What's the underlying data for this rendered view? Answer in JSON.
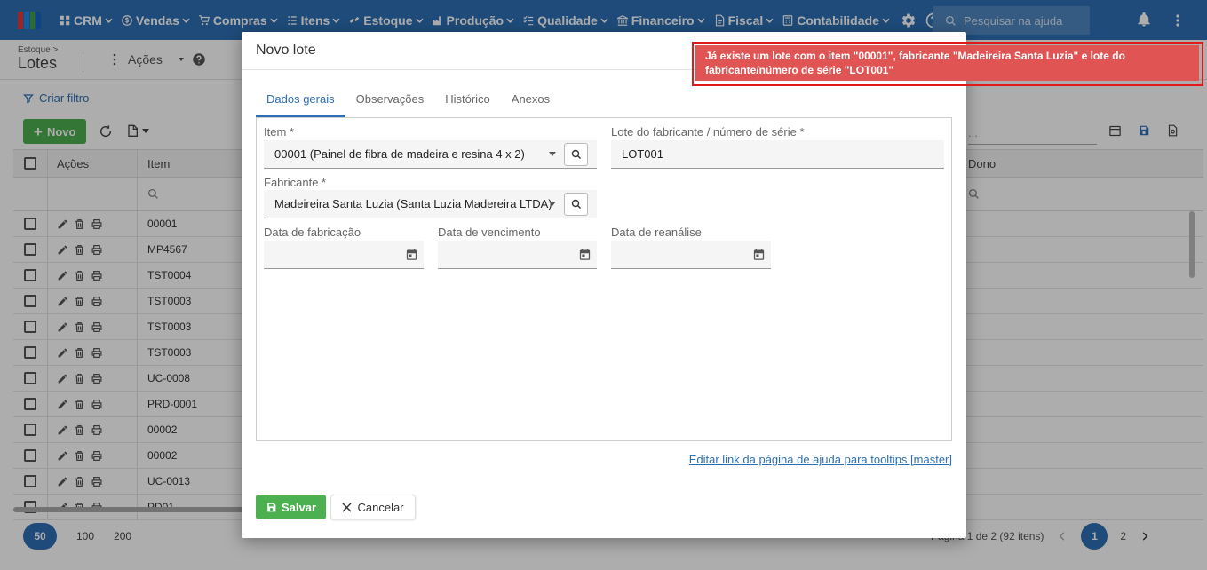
{
  "nav": {
    "items": [
      {
        "label": "CRM",
        "icon": "crm-icon"
      },
      {
        "label": "Vendas",
        "icon": "dollar-icon"
      },
      {
        "label": "Compras",
        "icon": "cart-icon"
      },
      {
        "label": "Itens",
        "icon": "items-icon"
      },
      {
        "label": "Estoque",
        "icon": "stock-icon"
      },
      {
        "label": "Produção",
        "icon": "factory-icon"
      },
      {
        "label": "Qualidade",
        "icon": "quality-icon"
      },
      {
        "label": "Financeiro",
        "icon": "finance-icon"
      },
      {
        "label": "Fiscal",
        "icon": "fiscal-icon"
      },
      {
        "label": "Contabilidade",
        "icon": "accounting-icon"
      }
    ],
    "search_placeholder": "Pesquisar na ajuda"
  },
  "page": {
    "breadcrumb": "Estoque >",
    "title": "Lotes",
    "actions_label": "Ações",
    "filter_label": "Criar filtro",
    "new_label": "Novo"
  },
  "grid": {
    "columns": [
      "Ações",
      "Item",
      "Dono"
    ],
    "rows": [
      "00001",
      "MP4567",
      "TST0004",
      "TST0003",
      "TST0003",
      "TST0003",
      "UC-0008",
      "PRD-0001",
      "00002",
      "00002",
      "UC-0013",
      "PD01"
    ],
    "search_placeholder": "...",
    "page_sizes": [
      "50",
      "100",
      "200"
    ],
    "page_info": "Página 1 de 2 (92 itens)",
    "pages": [
      "1",
      "2"
    ]
  },
  "modal": {
    "title": "Novo lote",
    "tabs": [
      "Dados gerais",
      "Observações",
      "Histórico",
      "Anexos"
    ],
    "fields": {
      "item_label": "Item *",
      "item_value": "00001 (Painel de fibra de madeira e resina 4 x 2)",
      "lot_label": "Lote do fabricante / número de série *",
      "lot_value": "LOT001",
      "manufacturer_label": "Fabricante *",
      "manufacturer_value": "Madeireira Santa Luzia (Santa Luzia Madereira LTDA)",
      "manufacture_date_label": "Data de fabricação",
      "expiry_date_label": "Data de vencimento",
      "reanalysis_date_label": "Data de reanálise"
    },
    "help_link": "Editar link da página de ajuda para tooltips [master]",
    "save_label": "Salvar",
    "cancel_label": "Cancelar"
  },
  "toast": {
    "message": "Já existe um lote com o item \"00001\", fabricante \"Madeireira Santa Luzia\" e lote do fabricante/número de série \"LOT001\"",
    "color": "#e05454"
  },
  "colors": {
    "primary": "#2d6fb4",
    "success": "#4caf50",
    "error_border": "#e01a1a"
  }
}
